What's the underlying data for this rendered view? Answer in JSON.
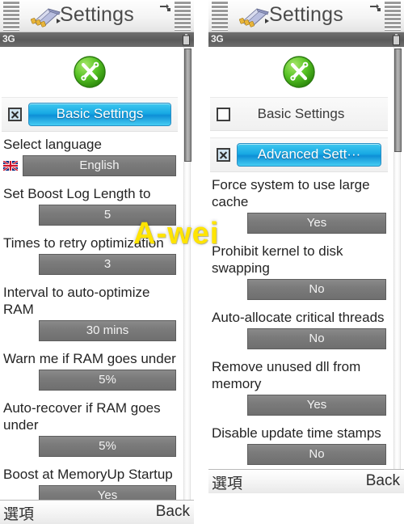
{
  "window": {
    "title": "Settings",
    "app_icon": "settings-card-icon",
    "connection_icon": "data-transfer-icon"
  },
  "status_bar": {
    "network": "3G",
    "battery_icon": "battery-icon"
  },
  "watermark": "A-wei",
  "left_panel": {
    "header_icon": "tools-green-icon",
    "section": {
      "checkbox_state": "checked",
      "label": "Basic Settings",
      "selected": true
    },
    "items": [
      {
        "label": "Select language",
        "value": "English",
        "icon": "uk-flag-icon"
      },
      {
        "label": "Set Boost Log Length to",
        "value": "5",
        "icon": ""
      },
      {
        "label": "Times to retry optimization",
        "value": "3",
        "icon": ""
      },
      {
        "label": "Interval to auto-optimize RAM",
        "value": "30 mins",
        "icon": ""
      },
      {
        "label": "Warn me if RAM goes under",
        "value": "5%",
        "icon": ""
      },
      {
        "label": "Auto-recover if RAM goes under",
        "value": "5%",
        "icon": ""
      },
      {
        "label": "Boost at MemoryUp Startup",
        "value": "Yes",
        "icon": ""
      }
    ],
    "softkeys": {
      "left": "選項",
      "right": "Back"
    }
  },
  "right_panel": {
    "header_icon": "tools-green-icon",
    "sections": [
      {
        "checkbox_state": "unchecked",
        "label": "Basic Settings",
        "selected": false
      },
      {
        "checkbox_state": "checked",
        "label": "Advanced Sett···",
        "selected": true
      }
    ],
    "items": [
      {
        "label": "Force system to use large cache",
        "value": "Yes"
      },
      {
        "label": "Prohibit kernel to disk swapping",
        "value": "No"
      },
      {
        "label": "Auto-allocate critical threads",
        "value": "No"
      },
      {
        "label": "Remove unused dll from memory",
        "value": "Yes"
      },
      {
        "label": "Disable update time stamps",
        "value": "No"
      }
    ],
    "softkeys": {
      "left": "選項",
      "right": "Back"
    }
  },
  "colors": {
    "accent_blue": "#18a9e4",
    "value_gray": "#7b7b7b",
    "status_gray": "#5a5a5a",
    "watermark_yellow": "#ffe400",
    "icon_green": "#5cc423"
  }
}
